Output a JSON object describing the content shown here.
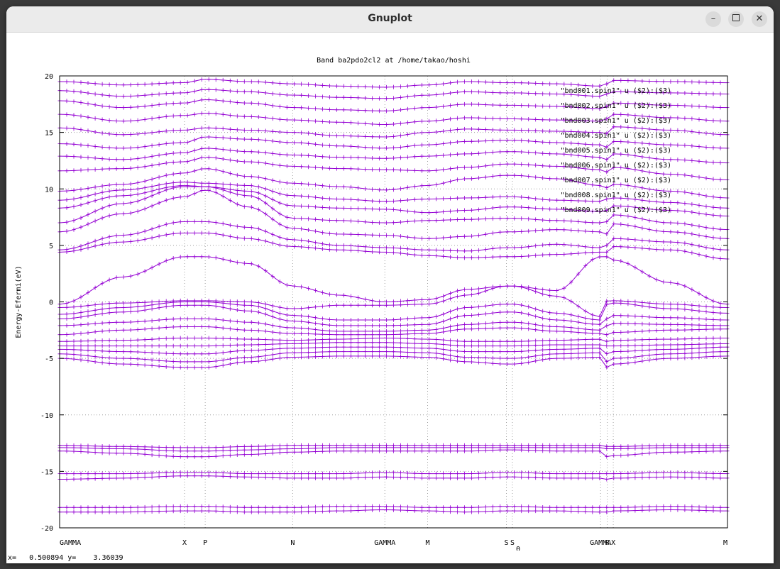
{
  "window": {
    "title": "Gnuplot",
    "minimize_icon": "minimize-icon",
    "maximize_icon": "maximize-icon",
    "close_icon": "close-icon"
  },
  "status_bar": {
    "text": "x=   0.500894 y=    3.36039"
  },
  "colors": {
    "band": "#9400d3",
    "grid": "#a0a0a0"
  },
  "chart_data": {
    "type": "line",
    "title": "Band ba2pdo2cl2 at /home/takao/hoshi",
    "ylabel": "Energy-Efermi(eV)",
    "ylim": [
      -20,
      20
    ],
    "yticks": [
      20,
      15,
      10,
      5,
      0,
      -5,
      -10,
      -15,
      -20
    ],
    "xlim": [
      0,
      1
    ],
    "grid": true,
    "legend_position": "top-right",
    "kpoints": [
      {
        "label": "GAMMA",
        "x": 0.0
      },
      {
        "label": "X",
        "x": 0.187
      },
      {
        "label": "P",
        "x": 0.218
      },
      {
        "label": "N",
        "x": 0.349
      },
      {
        "label": "GAMMA",
        "x": 0.487
      },
      {
        "label": "M",
        "x": 0.551
      },
      {
        "label": "S",
        "x": 0.669
      },
      {
        "label": "S",
        "x": 0.678
      },
      {
        "label": "GAMMA",
        "x": 0.81
      },
      {
        "label": "R",
        "x": 0.82
      },
      {
        "label": "X",
        "x": 0.829
      },
      {
        "label": "M",
        "x": 1.0
      }
    ],
    "kpoint_subscript": "0",
    "legend": [
      "\"bnd001.spin1\" u ($2):($3)",
      "\"bnd002.spin1\" u ($2):($3)",
      "\"bnd003.spin1\" u ($2):($3)",
      "\"bnd004.spin1\" u ($2):($3)",
      "\"bnd005.spin1\" u ($2):($3)",
      "\"bnd006.spin1\" u ($2):($3)",
      "\"bnd007.spin1\" u ($2):($3)",
      "\"bnd008.spin1\" u ($2):($3)",
      "\"bnd009.spin1\" u ($2):($3)"
    ],
    "x": [
      0.0,
      0.094,
      0.187,
      0.218,
      0.283,
      0.349,
      0.418,
      0.487,
      0.551,
      0.61,
      0.669,
      0.678,
      0.744,
      0.81,
      0.82,
      0.829,
      0.914,
      1.0
    ],
    "series": [
      {
        "values": [
          -18.6,
          -18.6,
          -18.5,
          -18.5,
          -18.6,
          -18.6,
          -18.5,
          -18.4,
          -18.5,
          -18.6,
          -18.5,
          -18.5,
          -18.5,
          -18.6,
          -18.6,
          -18.5,
          -18.4,
          -18.5
        ]
      },
      {
        "values": [
          -18.2,
          -18.2,
          -18.1,
          -18.1,
          -18.2,
          -18.2,
          -18.1,
          -18.1,
          -18.2,
          -18.2,
          -18.1,
          -18.1,
          -18.2,
          -18.2,
          -18.2,
          -18.2,
          -18.1,
          -18.2
        ]
      },
      {
        "values": [
          -15.7,
          -15.6,
          -15.4,
          -15.4,
          -15.5,
          -15.6,
          -15.6,
          -15.5,
          -15.6,
          -15.6,
          -15.5,
          -15.5,
          -15.6,
          -15.6,
          -15.7,
          -15.6,
          -15.5,
          -15.6
        ]
      },
      {
        "values": [
          -15.2,
          -15.2,
          -15.1,
          -15.1,
          -15.2,
          -15.2,
          -15.2,
          -15.1,
          -15.2,
          -15.2,
          -15.1,
          -15.1,
          -15.2,
          -15.2,
          -15.2,
          -15.2,
          -15.1,
          -15.2
        ]
      },
      {
        "values": [
          -13.2,
          -13.4,
          -13.7,
          -13.7,
          -13.5,
          -13.3,
          -13.2,
          -13.2,
          -13.2,
          -13.2,
          -13.1,
          -13.1,
          -13.2,
          -13.2,
          -13.7,
          -13.6,
          -13.3,
          -13.2
        ]
      },
      {
        "values": [
          -12.9,
          -13.0,
          -13.2,
          -13.2,
          -13.1,
          -13.0,
          -12.9,
          -12.9,
          -12.9,
          -12.9,
          -12.9,
          -12.9,
          -12.9,
          -12.9,
          -13.0,
          -13.0,
          -12.9,
          -12.9
        ]
      },
      {
        "values": [
          -12.7,
          -12.8,
          -12.9,
          -12.9,
          -12.8,
          -12.7,
          -12.7,
          -12.7,
          -12.7,
          -12.7,
          -12.7,
          -12.7,
          -12.7,
          -12.7,
          -12.8,
          -12.8,
          -12.7,
          -12.7
        ]
      },
      {
        "values": [
          -5.0,
          -5.5,
          -5.8,
          -5.8,
          -5.3,
          -4.9,
          -4.8,
          -4.8,
          -4.9,
          -5.3,
          -5.5,
          -5.5,
          -5.0,
          -4.9,
          -5.8,
          -5.5,
          -5.0,
          -4.8
        ]
      },
      {
        "values": [
          -4.6,
          -5.0,
          -5.3,
          -5.3,
          -4.9,
          -4.5,
          -4.4,
          -4.4,
          -4.5,
          -4.9,
          -5.0,
          -5.0,
          -4.6,
          -4.5,
          -5.3,
          -5.0,
          -4.6,
          -4.4
        ]
      },
      {
        "values": [
          -4.2,
          -4.4,
          -4.6,
          -4.6,
          -4.3,
          -4.1,
          -4.0,
          -4.0,
          -4.1,
          -4.4,
          -4.4,
          -4.4,
          -4.2,
          -4.1,
          -4.6,
          -4.4,
          -4.2,
          -4.0
        ]
      },
      {
        "values": [
          -3.9,
          -3.9,
          -3.9,
          -3.9,
          -3.8,
          -3.7,
          -3.6,
          -3.6,
          -3.7,
          -3.9,
          -3.9,
          -3.9,
          -3.8,
          -3.8,
          -3.9,
          -3.9,
          -3.8,
          -3.7
        ]
      },
      {
        "values": [
          -3.5,
          -3.4,
          -3.2,
          -3.2,
          -3.3,
          -3.4,
          -3.3,
          -3.2,
          -3.3,
          -3.5,
          -3.5,
          -3.5,
          -3.4,
          -3.3,
          -3.5,
          -3.4,
          -3.3,
          -3.2
        ]
      },
      {
        "values": [
          -2.9,
          -2.5,
          -2.2,
          -2.2,
          -2.5,
          -2.8,
          -2.9,
          -2.9,
          -2.8,
          -2.4,
          -2.3,
          -2.3,
          -2.6,
          -2.8,
          -2.9,
          -2.7,
          -2.5,
          -2.4
        ]
      },
      {
        "values": [
          -2.1,
          -1.8,
          -1.5,
          -1.5,
          -1.8,
          -2.3,
          -2.6,
          -2.6,
          -2.5,
          -2.0,
          -1.8,
          -1.8,
          -2.2,
          -2.5,
          -2.1,
          -1.9,
          -2.0,
          -2.1
        ]
      },
      {
        "values": [
          -1.5,
          -0.9,
          -0.3,
          -0.3,
          -0.8,
          -1.7,
          -2.1,
          -2.1,
          -2.0,
          -1.2,
          -0.9,
          -0.9,
          -1.6,
          -2.0,
          -1.5,
          -1.2,
          -1.4,
          -1.6
        ]
      },
      {
        "values": [
          -1.1,
          -0.5,
          0.0,
          0.0,
          -0.3,
          -1.2,
          -1.6,
          -1.6,
          -1.4,
          -0.5,
          -0.2,
          -0.2,
          -1.0,
          -1.6,
          -0.2,
          -0.1,
          -0.6,
          -1.0
        ]
      },
      {
        "values": [
          -0.5,
          -0.1,
          0.1,
          0.1,
          0.0,
          -0.6,
          -0.3,
          -0.3,
          -0.2,
          0.6,
          1.4,
          1.4,
          0.5,
          -1.3,
          0.1,
          0.1,
          -0.2,
          -0.5
        ]
      },
      {
        "values": [
          -0.2,
          2.2,
          4.0,
          4.0,
          3.4,
          1.4,
          0.6,
          0.0,
          0.2,
          1.1,
          1.4,
          1.4,
          1.0,
          4.0,
          4.0,
          3.7,
          1.7,
          -0.2
        ]
      },
      {
        "values": [
          4.4,
          5.3,
          6.1,
          6.1,
          5.6,
          4.9,
          4.6,
          4.4,
          4.1,
          3.9,
          4.0,
          4.0,
          4.2,
          4.4,
          4.4,
          4.9,
          4.6,
          3.8
        ]
      },
      {
        "values": [
          4.6,
          5.9,
          7.1,
          7.1,
          6.6,
          5.5,
          5.0,
          4.8,
          4.6,
          4.5,
          4.8,
          4.8,
          5.1,
          4.8,
          5.0,
          5.6,
          5.3,
          4.6
        ]
      },
      {
        "values": [
          6.2,
          7.8,
          9.3,
          9.9,
          8.4,
          6.5,
          6.0,
          5.9,
          5.6,
          5.8,
          6.2,
          6.2,
          6.4,
          6.2,
          6.0,
          6.9,
          6.2,
          5.6
        ]
      },
      {
        "values": [
          7.0,
          8.7,
          10.2,
          10.2,
          9.4,
          7.4,
          7.2,
          7.0,
          7.2,
          7.3,
          7.4,
          7.4,
          7.2,
          7.0,
          7.1,
          7.7,
          7.0,
          6.4
        ]
      },
      {
        "values": [
          8.3,
          9.4,
          10.3,
          10.2,
          9.8,
          8.5,
          8.3,
          8.2,
          7.9,
          8.1,
          8.4,
          8.4,
          8.2,
          8.0,
          8.1,
          8.5,
          8.1,
          7.6
        ]
      },
      {
        "values": [
          9.0,
          9.9,
          10.6,
          10.5,
          10.3,
          9.4,
          9.1,
          8.9,
          9.1,
          9.2,
          9.3,
          9.3,
          9.0,
          8.9,
          9.1,
          9.2,
          8.8,
          8.3
        ]
      },
      {
        "values": [
          9.8,
          10.4,
          11.4,
          11.8,
          11.1,
          10.5,
          10.2,
          9.9,
          10.3,
          10.9,
          11.2,
          11.2,
          10.9,
          10.3,
          10.1,
          10.4,
          9.8,
          9.2
        ]
      },
      {
        "values": [
          11.6,
          11.8,
          12.4,
          12.8,
          12.4,
          12.0,
          11.8,
          11.7,
          11.6,
          11.9,
          12.2,
          12.2,
          12.0,
          11.7,
          11.5,
          11.9,
          11.3,
          10.8
        ]
      },
      {
        "values": [
          12.9,
          12.6,
          13.2,
          13.6,
          13.3,
          13.0,
          12.8,
          12.7,
          12.9,
          13.1,
          13.3,
          13.3,
          13.1,
          12.8,
          12.6,
          13.1,
          12.6,
          12.3
        ]
      },
      {
        "values": [
          14.0,
          13.6,
          14.1,
          14.6,
          14.4,
          14.1,
          13.8,
          13.6,
          13.9,
          14.2,
          14.3,
          14.3,
          14.1,
          13.9,
          13.7,
          14.2,
          13.9,
          13.6
        ]
      },
      {
        "values": [
          15.4,
          14.8,
          15.2,
          15.4,
          15.2,
          15.0,
          14.7,
          14.6,
          15.0,
          15.3,
          15.2,
          15.2,
          15.1,
          15.0,
          14.9,
          15.5,
          15.2,
          14.8
        ]
      },
      {
        "values": [
          16.6,
          16.0,
          16.5,
          16.7,
          16.4,
          16.1,
          15.9,
          15.7,
          16.0,
          16.3,
          16.2,
          16.2,
          16.1,
          16.0,
          16.2,
          16.6,
          16.3,
          16.0
        ]
      },
      {
        "values": [
          17.8,
          17.2,
          17.6,
          17.9,
          17.6,
          17.2,
          17.0,
          16.9,
          17.2,
          17.5,
          17.4,
          17.4,
          17.3,
          17.1,
          17.3,
          17.6,
          17.4,
          17.2
        ]
      },
      {
        "values": [
          18.7,
          18.2,
          18.5,
          18.8,
          18.6,
          18.3,
          18.1,
          18.0,
          18.3,
          18.6,
          18.5,
          18.5,
          18.4,
          18.2,
          18.4,
          18.6,
          18.5,
          18.4
        ]
      },
      {
        "values": [
          19.5,
          19.2,
          19.4,
          19.7,
          19.5,
          19.3,
          19.1,
          19.0,
          19.2,
          19.5,
          19.4,
          19.4,
          19.3,
          19.1,
          19.3,
          19.6,
          19.5,
          19.4
        ]
      }
    ]
  }
}
